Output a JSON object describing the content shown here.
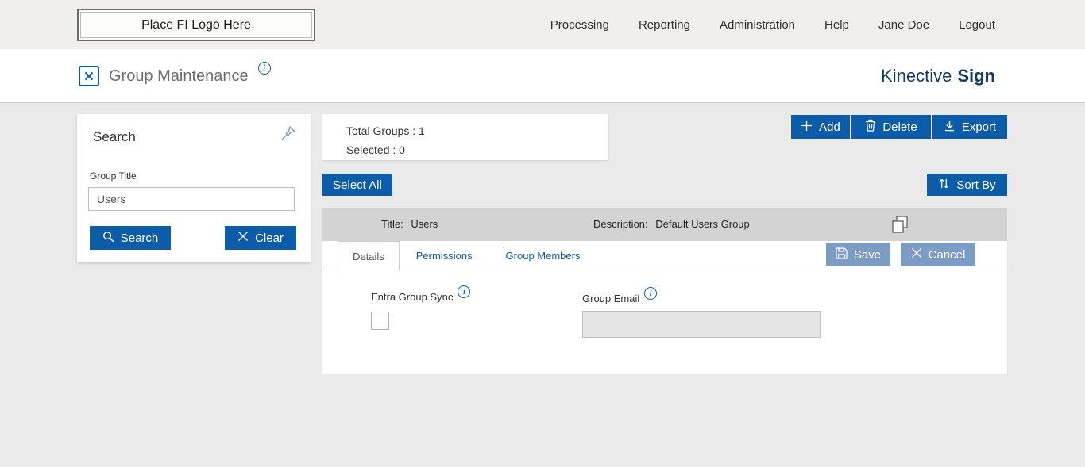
{
  "header": {
    "logo_placeholder": "Place FI Logo Here",
    "nav": [
      {
        "label": "Processing"
      },
      {
        "label": "Reporting"
      },
      {
        "label": "Administration"
      },
      {
        "label": "Help"
      },
      {
        "label": "Jane Doe"
      },
      {
        "label": "Logout"
      }
    ]
  },
  "titlebar": {
    "page_title": "Group Maintenance",
    "brand_first": "Kinective",
    "brand_second": "Sign"
  },
  "search_panel": {
    "title": "Search",
    "group_title_label": "Group Title",
    "group_title_value": "Users",
    "search_button": "Search",
    "clear_button": "Clear"
  },
  "summary": {
    "total_groups": "Total Groups : 1",
    "selected": "Selected : 0"
  },
  "toolbar": {
    "add": "Add",
    "delete": "Delete",
    "export": "Export",
    "select_all": "Select All",
    "sort_by": "Sort By"
  },
  "group_row": {
    "title_label": "Title:",
    "title_value": "Users",
    "description_label": "Description:",
    "description_value": "Default Users Group"
  },
  "tabs": [
    {
      "label": "Details",
      "active": true
    },
    {
      "label": "Permissions",
      "active": false
    },
    {
      "label": "Group Members",
      "active": false
    }
  ],
  "tab_actions": {
    "save": "Save",
    "cancel": "Cancel"
  },
  "form": {
    "entra_label": "Entra Group Sync",
    "entra_checked": false,
    "email_label": "Group Email",
    "email_value": ""
  },
  "colors": {
    "primary_blue": "#0d5ca9",
    "muted_blue": "#7d9cc3",
    "brand_navy": "#153a5f"
  }
}
